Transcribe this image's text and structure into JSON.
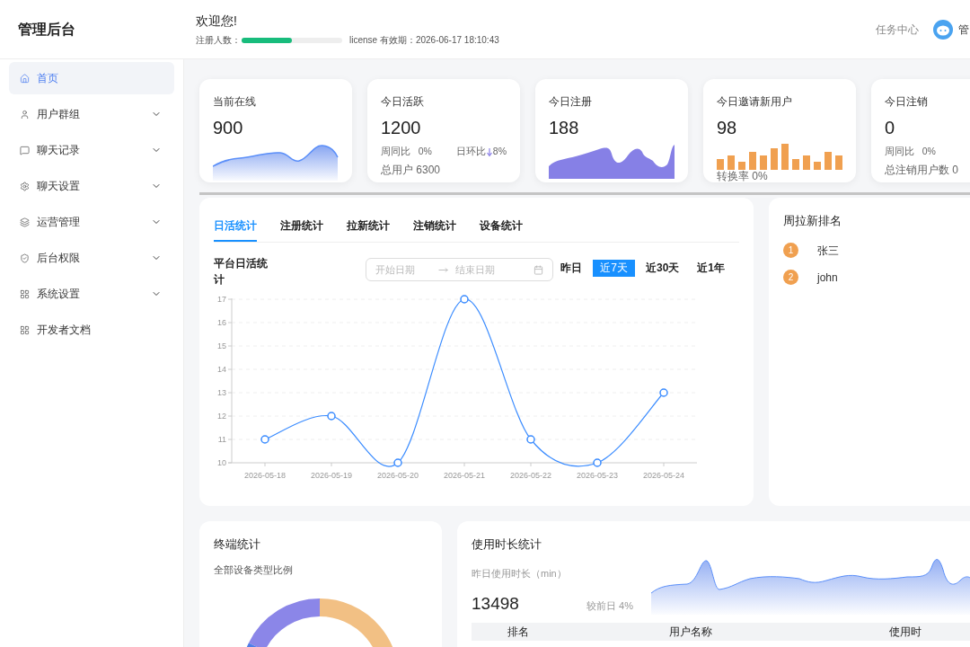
{
  "header": {
    "logo": "管理后台",
    "welcome": "欢迎您!",
    "registered_label": "注册人数：",
    "registered": {
      "level": 0.5
    },
    "license": "license 有效期：2026-06-17 18:10:43",
    "task_center": "任务中心",
    "user_name": "管"
  },
  "sidebar": {
    "items": [
      {
        "label": "首页",
        "kind": "link",
        "selected": true
      },
      {
        "label": "用户群组",
        "kind": "group",
        "selected": false
      },
      {
        "label": "聊天记录",
        "kind": "group",
        "selected": false
      },
      {
        "label": "聊天设置",
        "kind": "group",
        "selected": false
      },
      {
        "label": "运营管理",
        "kind": "group",
        "selected": false
      },
      {
        "label": "后台权限",
        "kind": "group",
        "selected": false
      },
      {
        "label": "系统设置",
        "kind": "group",
        "selected": false
      },
      {
        "label": "开发者文档",
        "kind": "link",
        "selected": false
      }
    ]
  },
  "stat_cards": [
    {
      "title": "当前在线",
      "value": "900",
      "kind": "area"
    },
    {
      "title": "今日活跃",
      "value": "1200",
      "kind": "stats",
      "week": "周同比",
      "week_value": "0%",
      "day": "日环比",
      "day_value": "8%",
      "total": "总用户 6300"
    },
    {
      "title": "今日注册",
      "value": "188",
      "kind": "filled"
    },
    {
      "title": "今日邀请新用户",
      "value": "98",
      "kind": "bars",
      "footer": "转换率 0%"
    },
    {
      "title": "今日注销",
      "value": "0",
      "kind": "stats",
      "week": "周同比",
      "week_value": "0%",
      "total": "总注销用户数 0"
    }
  ],
  "stats_panel": {
    "tabs": [
      {
        "label": "日活统计",
        "selected": true
      },
      {
        "label": "注册统计",
        "selected": false
      },
      {
        "label": "拉新统计",
        "selected": false
      },
      {
        "label": "注销统计",
        "selected": false
      },
      {
        "label": "设备统计",
        "selected": false
      }
    ],
    "subtitle": "平台日活统计",
    "start_placeholder": "开始日期",
    "end_placeholder": "结束日期",
    "ranges": [
      {
        "label": "昨日",
        "selected": false
      },
      {
        "label": "近7天",
        "selected": true
      },
      {
        "label": "近30天",
        "selected": false
      },
      {
        "label": "近1年",
        "selected": false
      }
    ],
    "chart_data": {
      "type": "line",
      "categories": [
        "2026-05-18",
        "2026-05-19",
        "2026-05-20",
        "2026-05-21",
        "2026-05-22",
        "2026-05-23",
        "2026-05-24"
      ],
      "series": [
        {
          "color": "#3b8cff",
          "marker": true,
          "values": [
            11,
            12,
            10,
            17,
            11,
            10,
            13
          ]
        }
      ],
      "grid": true,
      "ylim": [
        10,
        17
      ],
      "yticks": [
        10,
        11,
        12,
        13,
        14,
        15,
        16,
        17
      ]
    }
  },
  "ranking": {
    "title": "周拉新排名",
    "items": [
      {
        "rank": "1",
        "name": "张三"
      },
      {
        "rank": "2",
        "name": "john"
      }
    ]
  },
  "terminal": {
    "title": "终端统计",
    "subtitle": "全部设备类型比例"
  },
  "usage": {
    "title": "使用时长统计",
    "label": "昨日使用时长（min）",
    "value": "13498",
    "compare": "较前日 4%",
    "columns": [
      "排名",
      "用户名称",
      "使用时"
    ]
  }
}
